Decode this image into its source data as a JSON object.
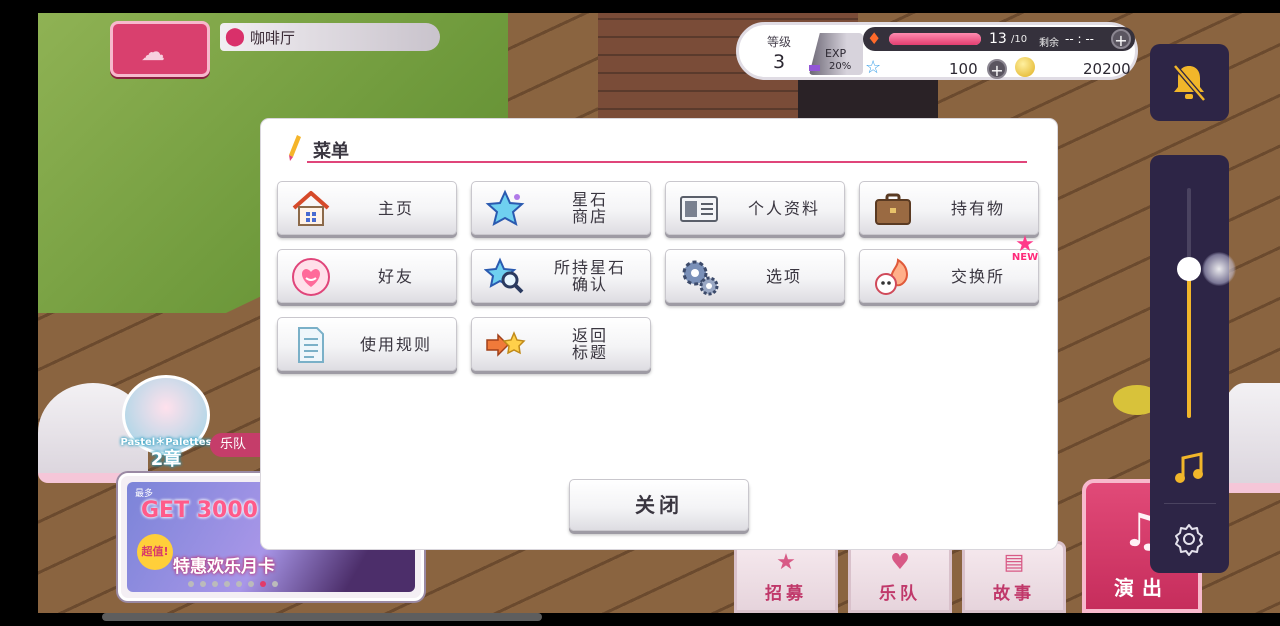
{
  "location": {
    "name": "咖啡厅"
  },
  "band": {
    "logo": "Pastel＊Palettes",
    "chapter": "2章",
    "tag": "乐队"
  },
  "banner": {
    "small": "最多",
    "headline": "GET 3000",
    "value_badge": "超值!",
    "card_name": "特惠欢乐月卡",
    "slide_count": 8,
    "active_slide": 6
  },
  "status": {
    "level_label": "等级",
    "level": "3",
    "exp_label": "EXP",
    "exp_percent": "20%",
    "exp_fraction": 0.2,
    "stamina": "13",
    "stamina_max": "/10",
    "stamina_fraction": 1.0,
    "remaining_label": "剩余",
    "remaining_time": "-- : --",
    "star_stones": "100",
    "coins": "20200"
  },
  "bottom_nav": [
    {
      "label": "招募",
      "icon": "gacha-icon"
    },
    {
      "label": "乐队",
      "icon": "band-icon"
    },
    {
      "label": "故事",
      "icon": "story-icon"
    }
  ],
  "live_button": {
    "label": "演出",
    "icon": "music-note-icon"
  },
  "controls": {
    "volume_fraction": 0.65,
    "icons": [
      "bell-mute-icon",
      "music-note-icon",
      "gear-icon"
    ]
  },
  "menu": {
    "title": "菜单",
    "items": [
      {
        "label": "主页",
        "icon": "home-icon"
      },
      {
        "label": "星石\n商店",
        "icon": "star-shop-icon"
      },
      {
        "label": "个人资料",
        "icon": "profile-card-icon"
      },
      {
        "label": "持有物",
        "icon": "bag-icon"
      },
      {
        "label": "好友",
        "icon": "friend-heart-icon"
      },
      {
        "label": "所持星石\n确认",
        "icon": "star-search-icon"
      },
      {
        "label": "选项",
        "icon": "gears-icon"
      },
      {
        "label": "交换所",
        "icon": "exchange-icon",
        "badge": "NEW"
      },
      {
        "label": "使用规则",
        "icon": "document-icon"
      },
      {
        "label": "返回\n标题",
        "icon": "return-title-icon"
      }
    ],
    "close_label": "关闭"
  },
  "colors": {
    "accent": "#e0457a",
    "panel_dark": "#2d2546",
    "volume": "#f1b62a"
  }
}
